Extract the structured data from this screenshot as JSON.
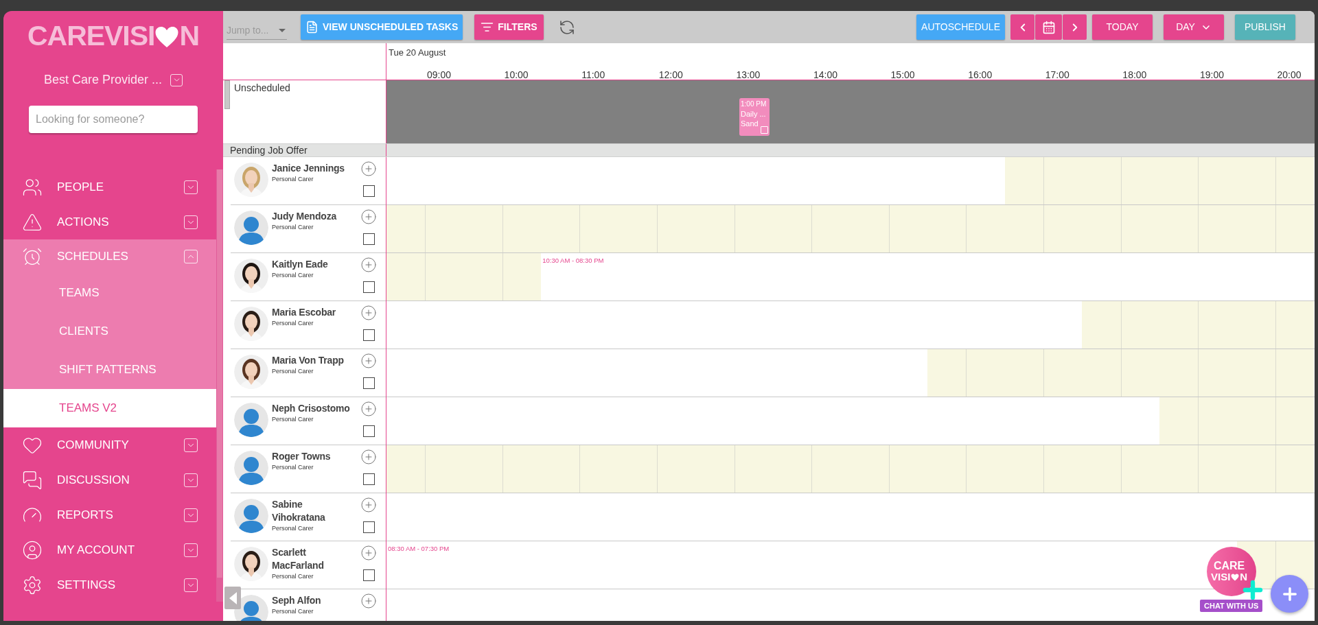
{
  "sidebar": {
    "logo": {
      "before": "CAREVISI",
      "after": "N"
    },
    "organization": "Best Care Provider ...",
    "search": {
      "placeholder": "Looking for someone?"
    },
    "items": [
      {
        "label": "PEOPLE",
        "expanded": false
      },
      {
        "label": "ACTIONS",
        "expanded": false
      },
      {
        "label": "SCHEDULES",
        "expanded": true,
        "children": [
          {
            "label": "TEAMS",
            "selected": false
          },
          {
            "label": "CLIENTS",
            "selected": false
          },
          {
            "label": "SHIFT PATTERNS",
            "selected": false
          },
          {
            "label": "TEAMS V2",
            "selected": true
          }
        ]
      },
      {
        "label": "COMMUNITY",
        "expanded": false
      },
      {
        "label": "DISCUSSION",
        "expanded": false
      },
      {
        "label": "REPORTS",
        "expanded": false
      },
      {
        "label": "MY ACCOUNT",
        "expanded": false
      },
      {
        "label": "SETTINGS",
        "expanded": false
      }
    ]
  },
  "toolbar": {
    "jump": {
      "placeholder": "Jump to..."
    },
    "view_unscheduled": "VIEW UNSCHEDULED TASKS",
    "filters": "FILTERS",
    "autoschedule": "AUTOSCHEDULE",
    "today": "TODAY",
    "view": "DAY",
    "publish": "PUBLISH"
  },
  "timeline": {
    "date": "Tue 20 August",
    "hours": [
      "09:00",
      "10:00",
      "11:00",
      "12:00",
      "13:00",
      "14:00",
      "15:00",
      "16:00",
      "17:00",
      "18:00",
      "19:00",
      "20:00"
    ]
  },
  "unscheduled": {
    "label": "Unscheduled",
    "tasks": [
      {
        "time": "1:00 PM",
        "title": "Daily ...",
        "client": "Sand"
      }
    ]
  },
  "pending": {
    "label": "Pending Job Offer"
  },
  "carers": [
    {
      "name": "Janice Jennings",
      "role": "Personal Carer",
      "checked": false,
      "unavailable": [
        false,
        false,
        false,
        false,
        false,
        false,
        false,
        false,
        false,
        false,
        false,
        false,
        false,
        false,
        false,
        false,
        true,
        true,
        true,
        true,
        true,
        true,
        true,
        true
      ]
    },
    {
      "name": "Judy Mendoza",
      "role": "Personal Carer",
      "avatar": {
        "kind": "default"
      },
      "checked": false,
      "unavailable": [
        true,
        true,
        true,
        true,
        true,
        true,
        true,
        true,
        true,
        true,
        true,
        true,
        true,
        true,
        true,
        true,
        true,
        true,
        true,
        true,
        true,
        true,
        true,
        true
      ]
    },
    {
      "name": "Kaitlyn Eade",
      "role": "Personal Carer",
      "checked": false,
      "availability": "10:30 AM - 08:30 PM",
      "unavailable": [
        true,
        true,
        true,
        true,
        false,
        false,
        false,
        false,
        false,
        false,
        false,
        false,
        false,
        false,
        false,
        false,
        false,
        false,
        false,
        false,
        false,
        false,
        false,
        false
      ]
    },
    {
      "name": "Maria Escobar",
      "role": "Personal Carer",
      "checked": false,
      "unavailable": [
        false,
        false,
        false,
        false,
        false,
        false,
        false,
        false,
        false,
        false,
        false,
        false,
        false,
        false,
        false,
        false,
        false,
        false,
        true,
        true,
        true,
        true,
        true,
        true
      ]
    },
    {
      "name": "Maria Von Trapp",
      "role": "Personal Carer",
      "checked": false,
      "unavailable": [
        false,
        false,
        false,
        false,
        false,
        false,
        false,
        false,
        false,
        false,
        false,
        false,
        false,
        false,
        true,
        true,
        true,
        true,
        true,
        true,
        true,
        true,
        true,
        true
      ]
    },
    {
      "name": "Neph Crisostomo",
      "role": "Personal Carer",
      "avatar": {
        "kind": "default"
      },
      "checked": false,
      "unavailable": [
        false,
        false,
        false,
        false,
        false,
        false,
        false,
        false,
        false,
        false,
        false,
        false,
        false,
        false,
        false,
        false,
        false,
        false,
        false,
        false,
        true,
        true,
        true,
        true
      ]
    },
    {
      "name": "Roger Towns",
      "role": "Personal Carer",
      "avatar": {
        "kind": "default"
      },
      "checked": false,
      "unavailable": [
        true,
        true,
        true,
        true,
        true,
        true,
        true,
        true,
        true,
        true,
        true,
        true,
        true,
        true,
        true,
        true,
        true,
        true,
        true,
        true,
        true,
        true,
        true,
        true
      ]
    },
    {
      "name": "Sabine Vihokratana",
      "role": "Personal Carer",
      "avatar": {
        "kind": "default"
      },
      "checked": false,
      "unavailable": [
        false,
        false,
        false,
        false,
        false,
        false,
        false,
        false,
        false,
        false,
        false,
        false,
        false,
        false,
        false,
        false,
        false,
        false,
        false,
        false,
        false,
        false,
        false,
        false
      ]
    },
    {
      "name": "Scarlett MacFarland",
      "role": "Personal Carer",
      "checked": false,
      "availability": "08:30 AM - 07:30 PM",
      "unavailable": [
        false,
        false,
        false,
        false,
        false,
        false,
        false,
        false,
        false,
        false,
        false,
        false,
        false,
        false,
        false,
        false,
        false,
        false,
        false,
        false,
        false,
        false,
        true,
        true
      ]
    },
    {
      "name": "Seph Alfon",
      "role": "Personal Carer",
      "avatar": {
        "kind": "default"
      },
      "unavailable": [
        false,
        false,
        false,
        false,
        false,
        false,
        false,
        false,
        false,
        false,
        false,
        false,
        false,
        false,
        false,
        false,
        false,
        false,
        false,
        false,
        false,
        false,
        false,
        false
      ]
    }
  ],
  "chat": {
    "logo": {
      "line1": "CARE",
      "before": "VISI",
      "after": "N"
    },
    "label": "CHAT WITH US"
  }
}
